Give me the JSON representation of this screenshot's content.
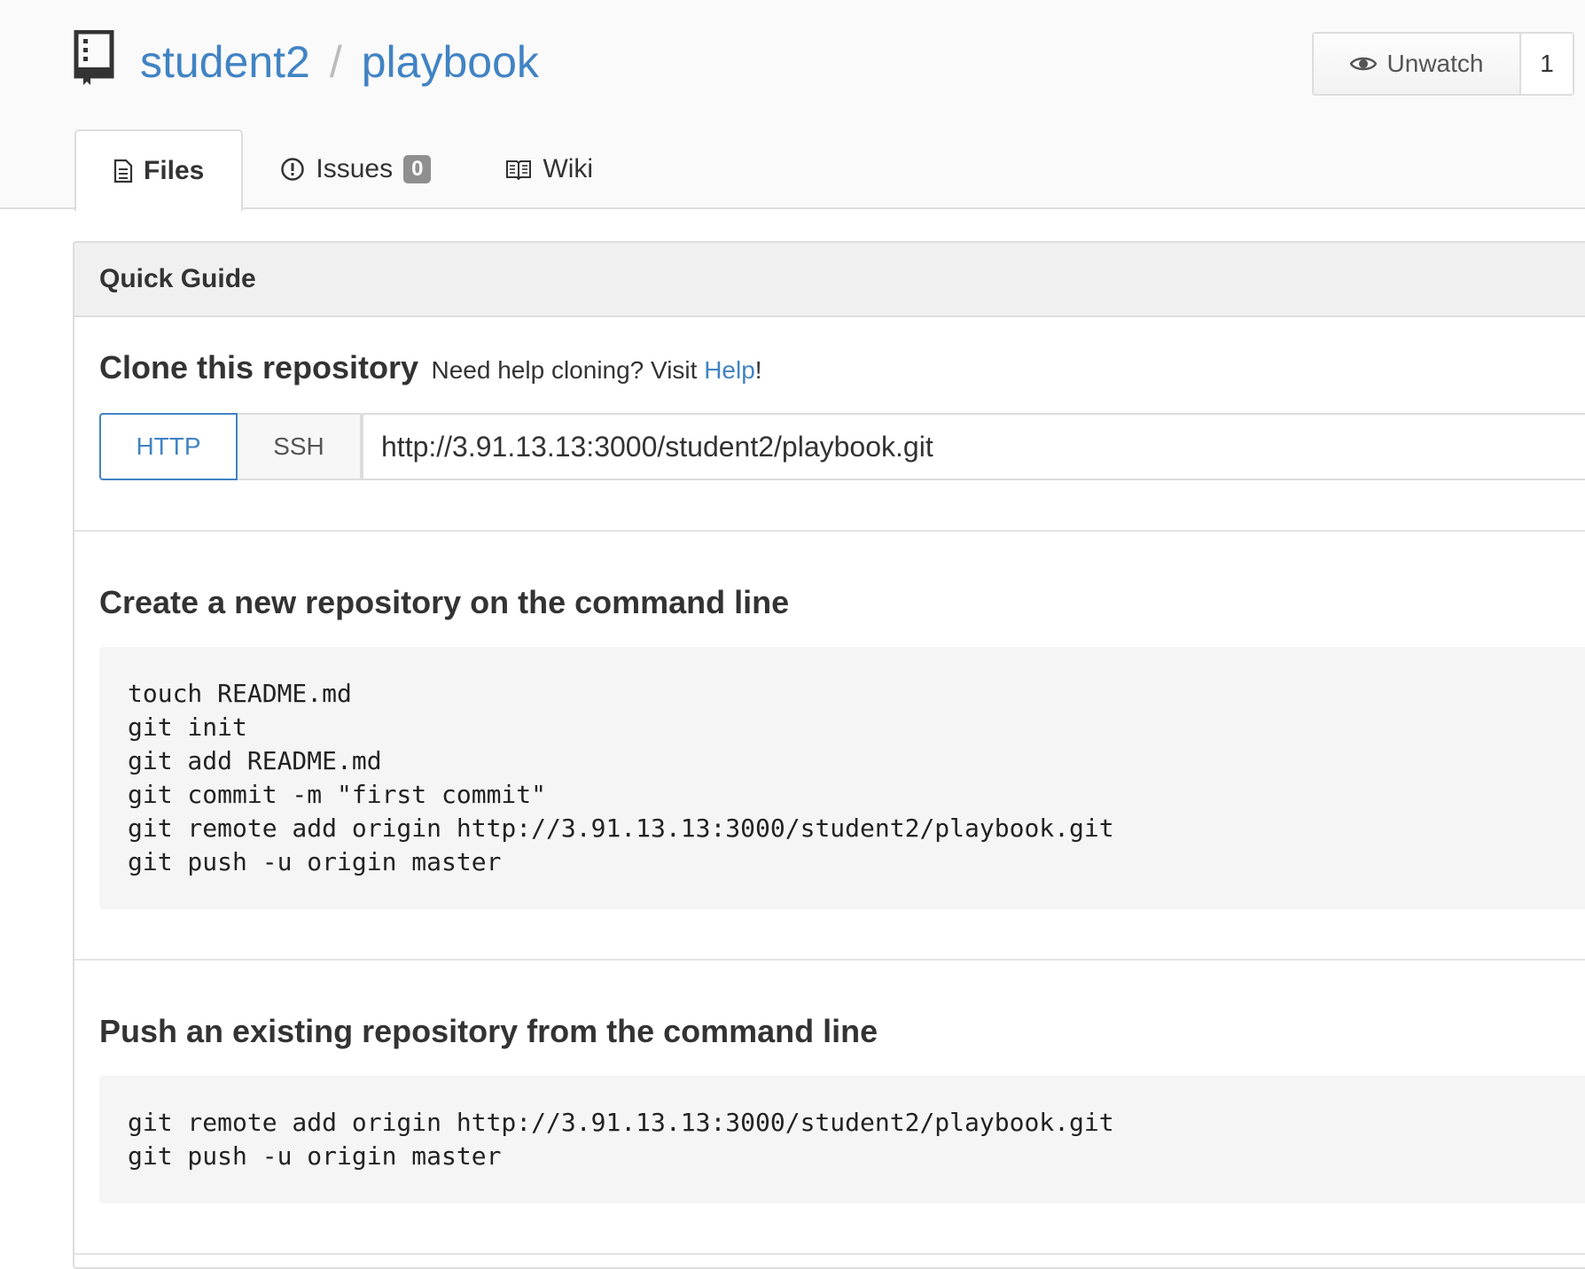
{
  "repo": {
    "owner": "student2",
    "separator": "/",
    "name": "playbook"
  },
  "watch": {
    "label": "Unwatch",
    "count": "1"
  },
  "tabs": [
    {
      "label": "Files",
      "icon": "file-text-icon",
      "active": true
    },
    {
      "label": "Issues",
      "icon": "issue-opened-icon",
      "badge": "0"
    },
    {
      "label": "Wiki",
      "icon": "book-icon"
    }
  ],
  "guide": {
    "header": "Quick Guide",
    "clone": {
      "title": "Clone this repository",
      "help_prefix": "Need help cloning? Visit",
      "help_link": "Help",
      "help_suffix": "!",
      "protocols": [
        "HTTP",
        "SSH"
      ],
      "selected_protocol": "HTTP",
      "url": "http://3.91.13.13:3000/student2/playbook.git"
    },
    "new_repo": {
      "title": "Create a new repository on the command line",
      "code": "touch README.md\ngit init\ngit add README.md\ngit commit -m \"first commit\"\ngit remote add origin http://3.91.13.13:3000/student2/playbook.git\ngit push -u origin master"
    },
    "existing_repo": {
      "title": "Push an existing repository from the command line",
      "code": "git remote add origin http://3.91.13.13:3000/student2/playbook.git\ngit push -u origin master"
    }
  },
  "colors": {
    "link": "#4183c4",
    "header_bg": "#fafafa",
    "code_bg": "#f5f5f5",
    "badge_bg": "#8f8f8f"
  }
}
